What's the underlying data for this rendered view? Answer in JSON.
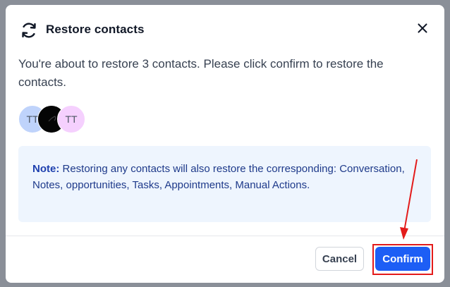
{
  "dialog": {
    "title": "Restore contacts",
    "message": "You're about to restore 3 contacts. Please click confirm to restore the contacts.",
    "avatars": [
      {
        "initials": "TT",
        "color": "#bfd3fb"
      },
      {
        "initials": "",
        "color": "#050505"
      },
      {
        "initials": "TT",
        "color": "#f5d0fe"
      }
    ],
    "note": {
      "label": "Note:",
      "text": " Restoring any contacts will also restore the corresponding: Conversation, Notes, opportunities, Tasks, Appointments, Manual Actions."
    },
    "buttons": {
      "cancel": "Cancel",
      "confirm": "Confirm"
    }
  },
  "colors": {
    "confirm": "#1d5ef5",
    "note_background": "#eef5fe",
    "annotation": "#e31b1b",
    "backdrop": "#8a8f98"
  },
  "icons": {
    "header": "refresh-icon",
    "close": "close-icon"
  }
}
